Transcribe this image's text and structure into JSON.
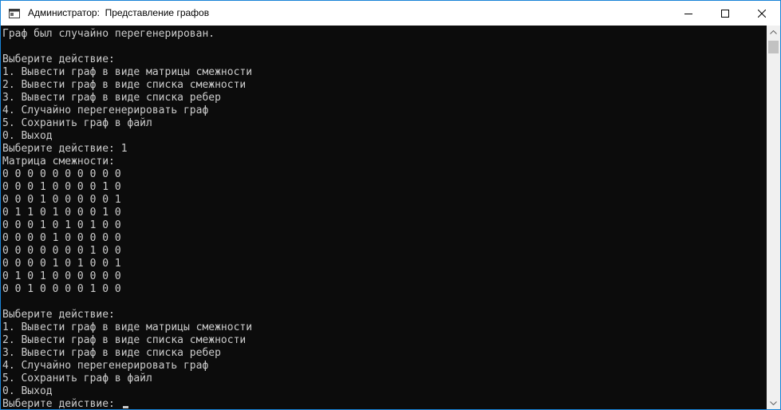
{
  "window": {
    "title": "Администратор:  Представление графов"
  },
  "console": {
    "lines": [
      "Граф был случайно перегенерирован.",
      "",
      "Выберите действие:",
      "1. Вывести граф в виде матрицы смежности",
      "2. Вывести граф в виде списка смежности",
      "3. Вывести граф в виде списка ребер",
      "4. Случайно перегенерировать граф",
      "5. Сохранить граф в файл",
      "0. Выход",
      "Выберите действие: 1",
      "Матрица смежности:",
      "0 0 0 0 0 0 0 0 0 0",
      "0 0 0 1 0 0 0 0 1 0",
      "0 0 0 1 0 0 0 0 0 1",
      "0 1 1 0 1 0 0 0 1 0",
      "0 0 0 1 0 1 0 1 0 0",
      "0 0 0 0 1 0 0 0 0 0",
      "0 0 0 0 0 0 0 1 0 0",
      "0 0 0 0 1 0 1 0 0 1",
      "0 1 0 1 0 0 0 0 0 0",
      "0 0 1 0 0 0 0 1 0 0",
      "",
      "Выберите действие:",
      "1. Вывести граф в виде матрицы смежности",
      "2. Вывести граф в виде списка смежности",
      "3. Вывести граф в виде списка ребер",
      "4. Случайно перегенерировать граф",
      "5. Сохранить граф в файл",
      "0. Выход"
    ],
    "prompt": "Выберите действие: "
  },
  "colors": {
    "console_bg": "#0c0c0c",
    "console_fg": "#cccccc",
    "titlebar_bg": "#ffffff",
    "window_border": "#1883d7"
  },
  "icons": {
    "app": "console-app-icon",
    "minimize": "minimize-icon",
    "maximize": "maximize-icon",
    "close": "close-icon",
    "scroll_up": "arrow-up-icon",
    "scroll_down": "arrow-down-icon"
  }
}
